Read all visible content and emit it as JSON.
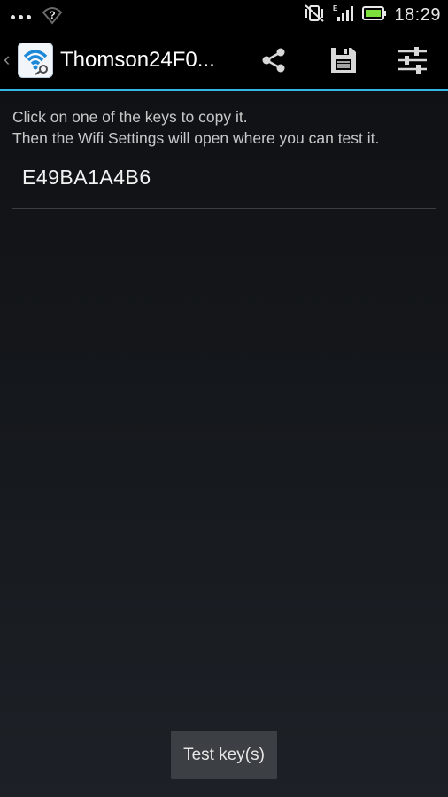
{
  "status_bar": {
    "time": "18:29",
    "icons": [
      "more-dots-icon",
      "wifi-question-icon",
      "vibrate-muted-icon",
      "signal-e-icon",
      "battery-icon"
    ],
    "battery_color": "#7ee03a"
  },
  "action_bar": {
    "title": "Thomson24F0...",
    "app_icon": "wifi-key-app-icon",
    "actions": [
      "share-icon",
      "save-icon",
      "settings-sliders-icon"
    ],
    "accent_color": "#33b5e5"
  },
  "main": {
    "instruction_line1": "Click on one of the keys to copy it.",
    "instruction_line2": "Then the Wifi Settings will open where you can test it.",
    "keys": [
      "E49BA1A4B6"
    ],
    "test_button_label": "Test key(s)"
  }
}
